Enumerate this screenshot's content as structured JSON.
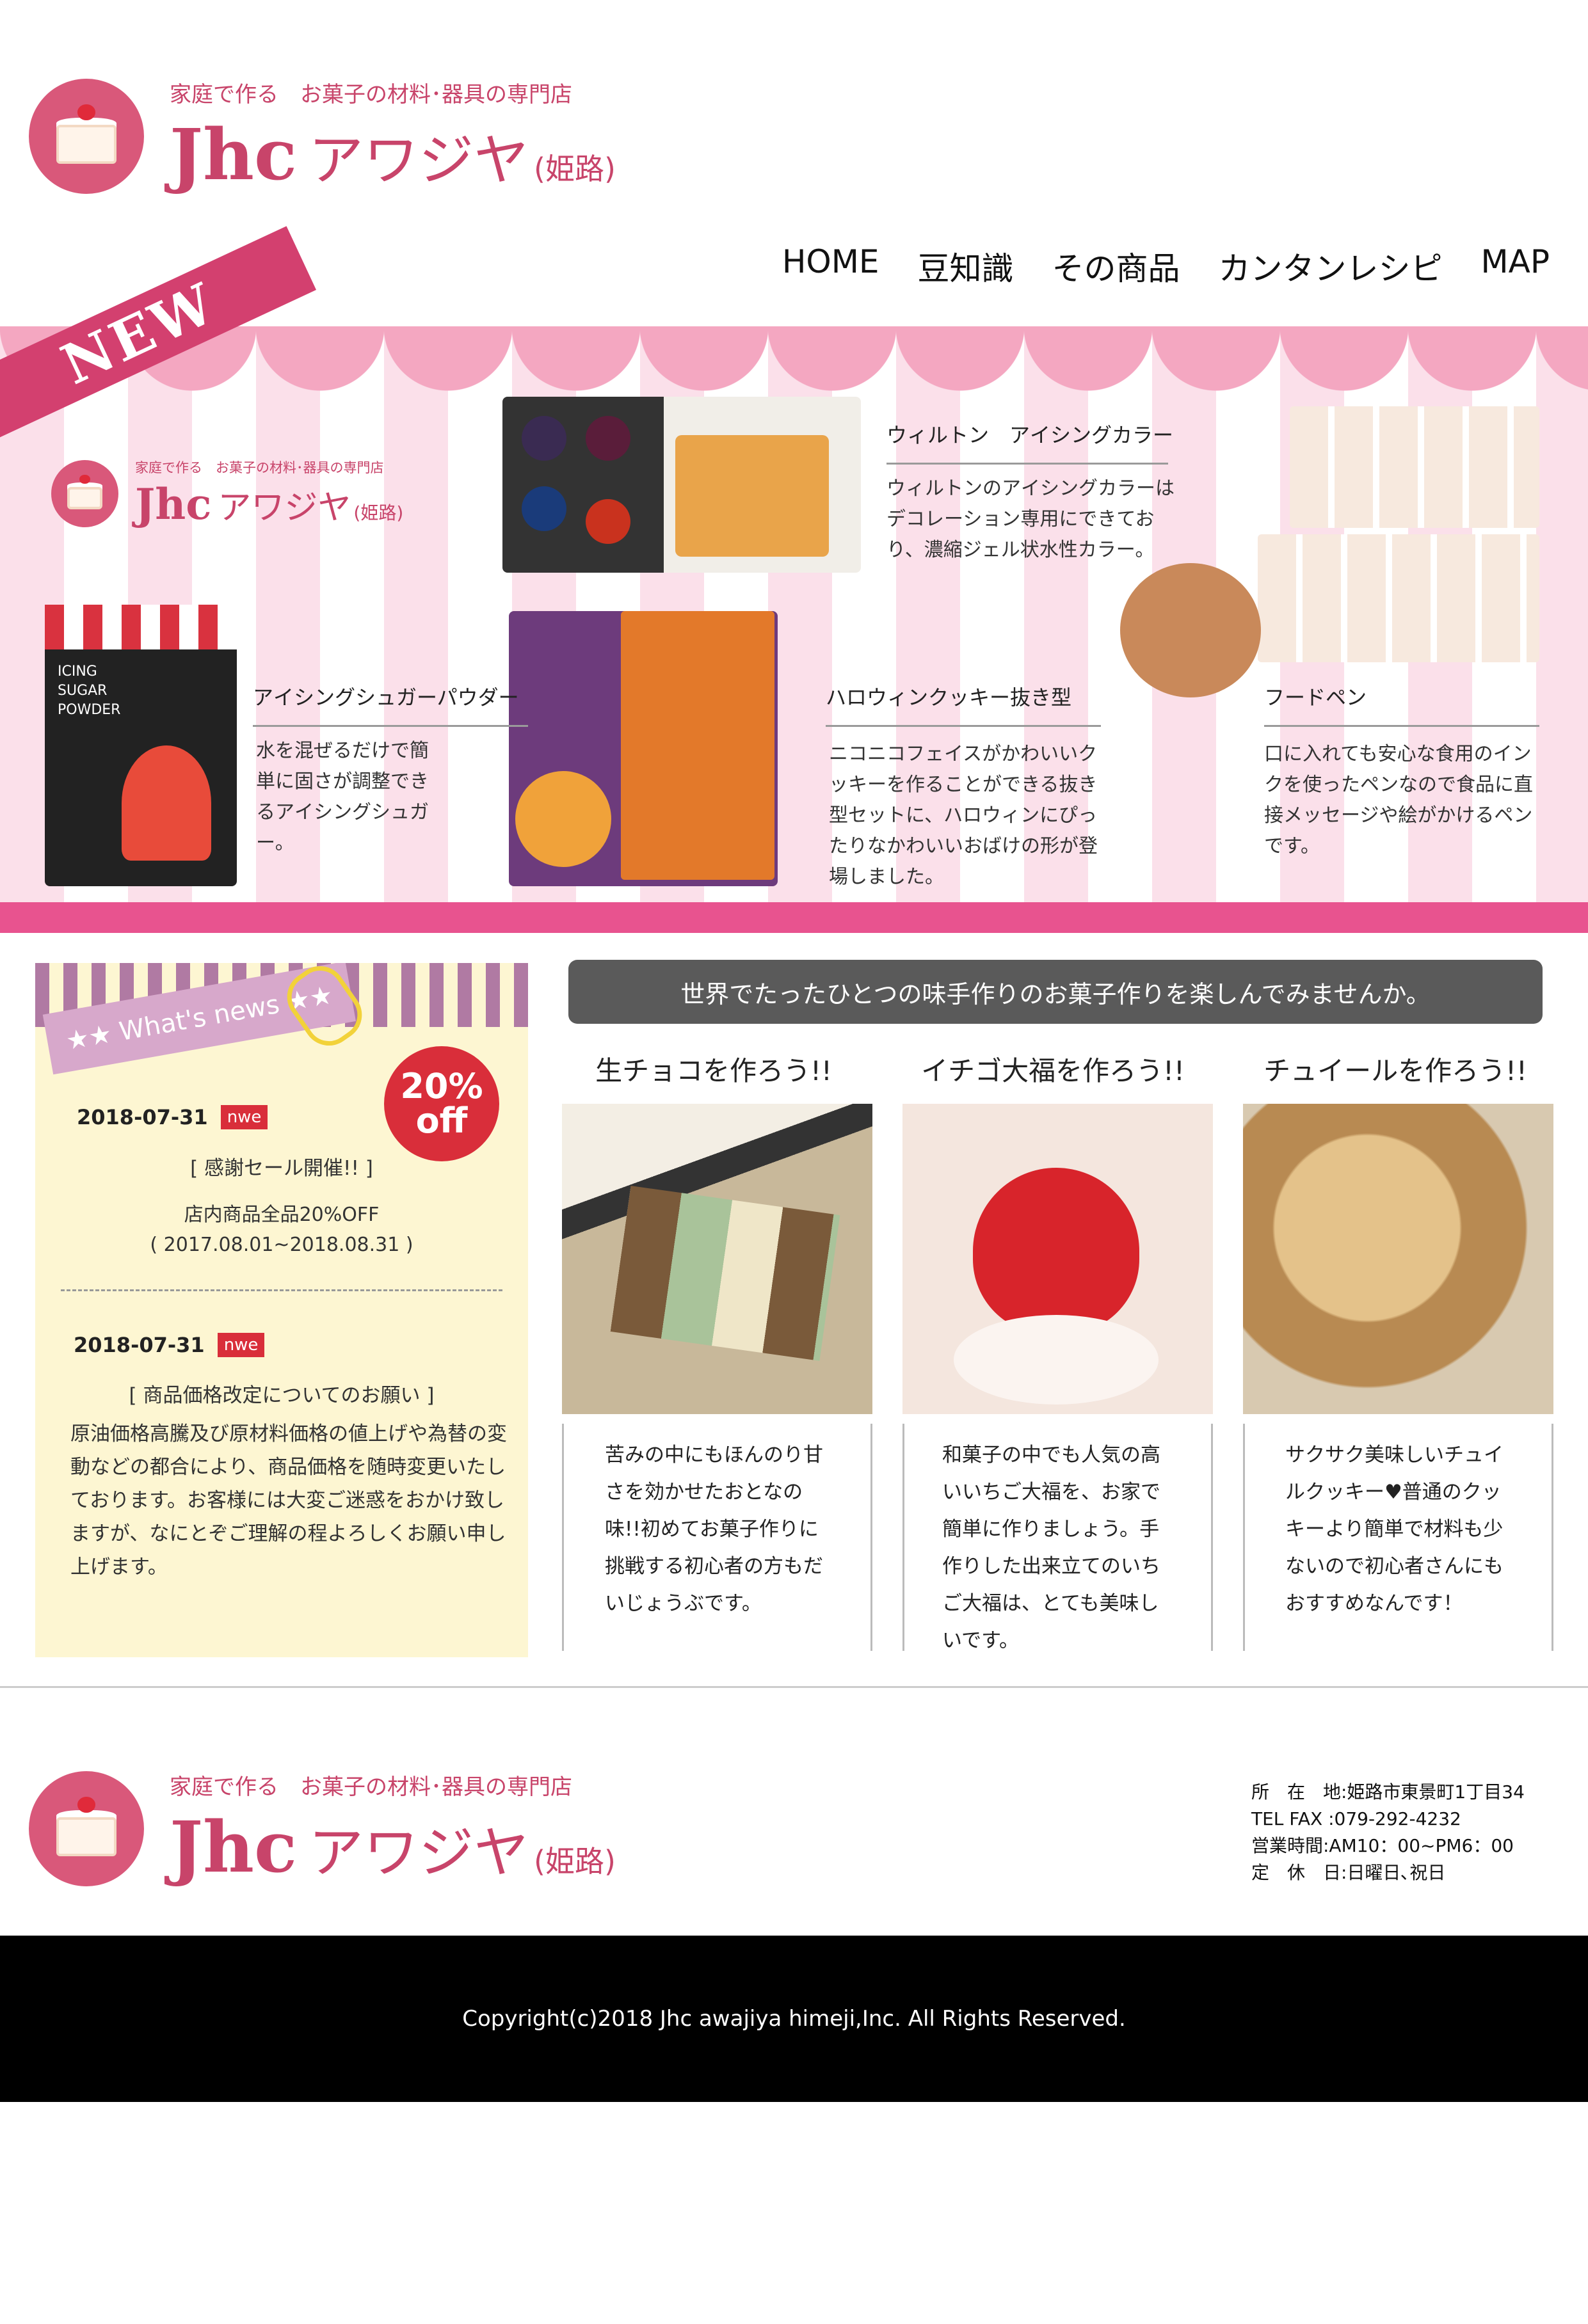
{
  "brand": {
    "tagline": "家庭で作る　お菓子の材料･器具の専門店",
    "name_jhc": "Jhc",
    "name_awajiya": "アワジヤ",
    "name_city": "(姫路)"
  },
  "nav": {
    "items": [
      "HOME",
      "豆知識",
      "その商品",
      "カンタンレシピ",
      "MAP"
    ]
  },
  "banner": {
    "new_label": "NEW",
    "products": [
      {
        "title": "ウィルトン　アイシングカラー",
        "desc": "ウィルトンのアイシングカラーはデコレーション専用にできており、濃縮ジェル状水性カラー。"
      },
      {
        "title": "アイシングシュガーパウダー",
        "desc": "水を混ぜるだけで簡単に固さが調整できるアイシングシュガー。"
      },
      {
        "title": "ハロウィンクッキー抜き型",
        "desc": "ニコニコフェイスがかわいいクッキーを作ることができる抜き型セットに、ハロウィンにぴったりなかわいいおばけの形が登場しました。"
      },
      {
        "title": "フードペン",
        "desc": "口に入れても安心な食用のインクを使ったペンなので食品に直接メッセージや絵がかけるペンです。"
      }
    ],
    "package_text": "ICING SUGAR POWDER"
  },
  "news": {
    "header": "What's news",
    "badge_top": "20%",
    "badge_bottom": "off",
    "items": [
      {
        "date": "2018-07-31",
        "tag": "nwe",
        "title": "[ 感謝セール開催!! ]",
        "line1": "店内商品全品20%OFF",
        "line2": "( 2017.08.01~2018.08.31 )"
      },
      {
        "date": "2018-07-31",
        "tag": "nwe",
        "title": "[ 商品価格改定についてのお願い ]",
        "body": "原油価格高騰及び原材料価格の値上げや為替の変動などの都合により、商品価格を随時変更いたしております。お客様には大変ご迷惑をおかけ致しますが、なにとぞご理解の程よろしくお願い申し上げます。"
      }
    ]
  },
  "recipes": {
    "heading": "世界でたったひとつの味手作りのお菓子作りを楽しんでみませんか。",
    "items": [
      {
        "title": "生チョコを作ろう!!",
        "desc": "苦みの中にもほんのり甘さを効かせたおとなの味!!初めてお菓子作りに挑戦する初心者の方もだいじょうぶです。"
      },
      {
        "title": "イチゴ大福を作ろう!!",
        "desc": "和菓子の中でも人気の高いいちご大福を、お家で簡単に作りましょう。手作りした出来立てのいちご大福は、とても美味しいです。"
      },
      {
        "title": "チュイールを作ろう!!",
        "desc": "サクサク美味しいチュイルクッキー♥普通のクッキーより簡単で材料も少ないので初心者さんにもおすすめなんです！"
      }
    ]
  },
  "store_info": {
    "address": "所　在　地:姫路市東景町1丁目34",
    "tel": "TEL FAX :079-292-4232",
    "hours": "営業時間:AM10：00~PM6：00",
    "closed": "定　休　日:日曜日､祝日"
  },
  "footer": {
    "copyright": "Copyright(c)2018 Jhc awajiya himeji,Inc. All Rights Reserved."
  }
}
